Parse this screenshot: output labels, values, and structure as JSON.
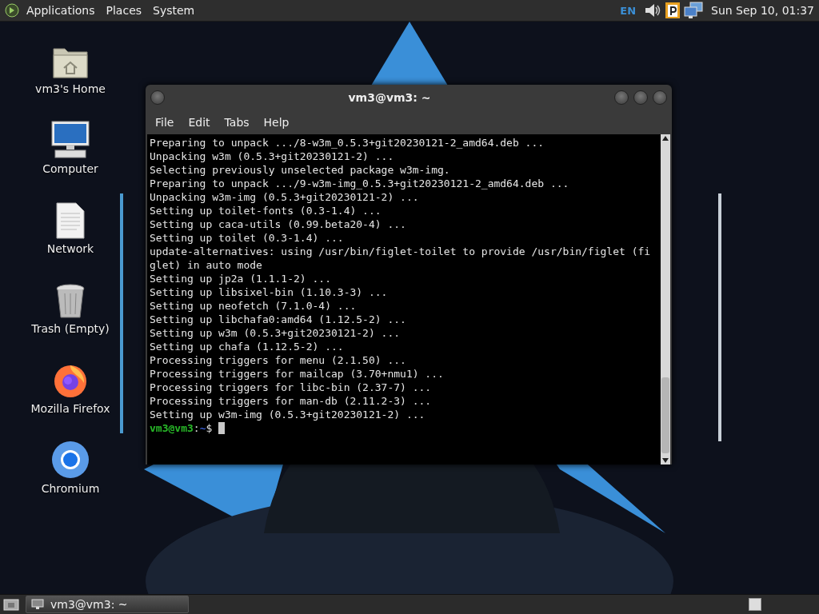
{
  "top_panel": {
    "menus": [
      "Applications",
      "Places",
      "System"
    ],
    "keyboard_layout": "EN",
    "clock": "Sun Sep 10, 01:37"
  },
  "desktop_icons": [
    {
      "kind": "home",
      "label": "vm3's Home"
    },
    {
      "kind": "computer",
      "label": "Computer"
    },
    {
      "kind": "network",
      "label": "Network"
    },
    {
      "kind": "trash",
      "label": "Trash (Empty)"
    },
    {
      "kind": "firefox",
      "label": "Mozilla Firefox"
    },
    {
      "kind": "chromium",
      "label": "Chromium"
    }
  ],
  "terminal": {
    "title": "vm3@vm3: ~",
    "menu": [
      "File",
      "Edit",
      "Tabs",
      "Help"
    ],
    "lines": [
      "Preparing to unpack .../8-w3m_0.5.3+git20230121-2_amd64.deb ...",
      "Unpacking w3m (0.5.3+git20230121-2) ...",
      "Selecting previously unselected package w3m-img.",
      "Preparing to unpack .../9-w3m-img_0.5.3+git20230121-2_amd64.deb ...",
      "Unpacking w3m-img (0.5.3+git20230121-2) ...",
      "Setting up toilet-fonts (0.3-1.4) ...",
      "Setting up caca-utils (0.99.beta20-4) ...",
      "Setting up toilet (0.3-1.4) ...",
      "update-alternatives: using /usr/bin/figlet-toilet to provide /usr/bin/figlet (fi",
      "glet) in auto mode",
      "Setting up jp2a (1.1.1-2) ...",
      "Setting up libsixel-bin (1.10.3-3) ...",
      "Setting up neofetch (7.1.0-4) ...",
      "Setting up libchafa0:amd64 (1.12.5-2) ...",
      "Setting up w3m (0.5.3+git20230121-2) ...",
      "Setting up chafa (1.12.5-2) ...",
      "Processing triggers for menu (2.1.50) ...",
      "Processing triggers for mailcap (3.70+nmu1) ...",
      "Processing triggers for libc-bin (2.37-7) ...",
      "Processing triggers for man-db (2.11.2-3) ...",
      "Setting up w3m-img (0.5.3+git20230121-2) ..."
    ],
    "prompt": [
      {
        "kind": "user",
        "text": "vm3@vm3"
      },
      {
        "kind": "plain",
        "text": ":"
      },
      {
        "kind": "path",
        "text": "~"
      },
      {
        "kind": "plain",
        "text": "$ "
      }
    ]
  },
  "taskbar": {
    "tasks": [
      {
        "label": "vm3@vm3: ~",
        "selected": true
      }
    ]
  }
}
